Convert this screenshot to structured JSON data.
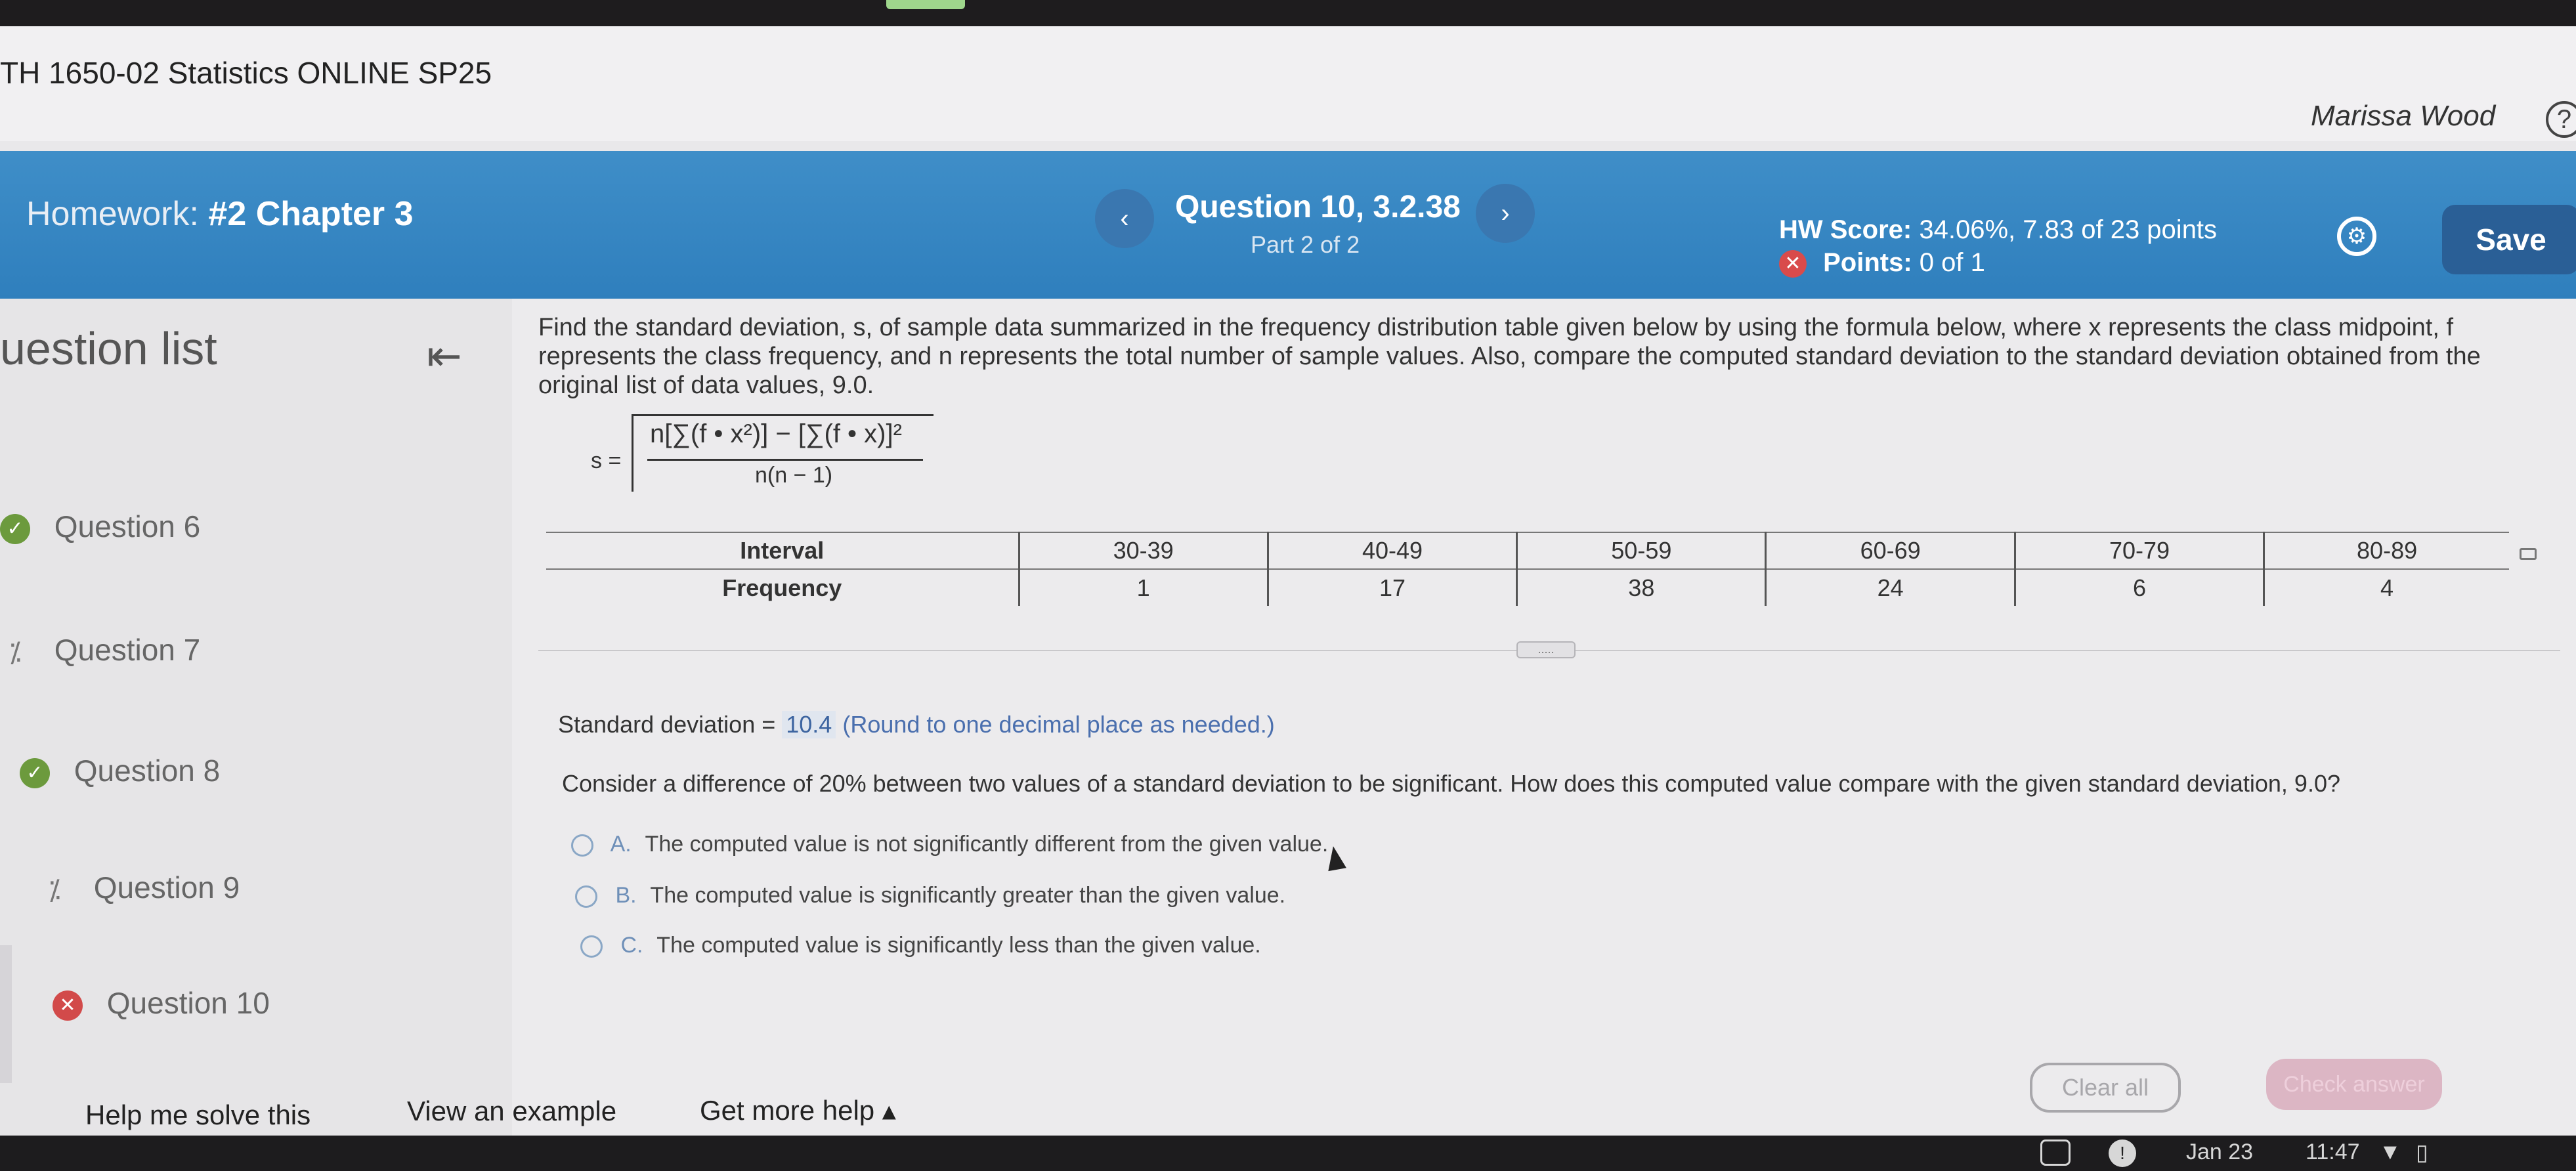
{
  "course": {
    "title": "TH 1650-02 Statistics ONLINE SP25",
    "user": "Marissa Wood"
  },
  "header": {
    "homework_prefix": "Homework:",
    "homework_name": "#2 Chapter 3",
    "question_title": "Question 10, 3.2.38",
    "question_part": "Part 2 of 2",
    "score_label": "HW Score:",
    "score_value": "34.06%, 7.83 of 23 points",
    "points_label": "Points:",
    "points_value": "0 of 1",
    "save_label": "Save",
    "prev_icon": "chevron-left-icon",
    "next_icon": "chevron-right-icon"
  },
  "sidebar": {
    "title": "uestion list",
    "items": [
      {
        "label": "Question 6",
        "status": "correct"
      },
      {
        "label": "Question 7",
        "status": "partial"
      },
      {
        "label": "Question 8",
        "status": "correct"
      },
      {
        "label": "Question 9",
        "status": "partial"
      },
      {
        "label": "Question 10",
        "status": "incorrect"
      }
    ]
  },
  "problem": {
    "prompt": "Find the standard deviation, s, of sample data summarized in the frequency distribution table given below by using the formula below, where x represents the class midpoint, f represents the class frequency, and n represents the total number of sample values. Also, compare the computed standard deviation to the standard deviation obtained from the original list of data values, 9.0.",
    "formula_lhs": "s =",
    "formula_numerator": "n[∑(f • x²)] − [∑(f • x)]²",
    "formula_denominator": "n(n − 1)",
    "table": {
      "row_labels": [
        "Interval",
        "Frequency"
      ],
      "intervals": [
        "30-39",
        "40-49",
        "50-59",
        "60-69",
        "70-79",
        "80-89"
      ],
      "frequencies": [
        "1",
        "17",
        "38",
        "24",
        "6",
        "4"
      ]
    },
    "more_label": "....."
  },
  "answer": {
    "prefix": "Standard deviation =",
    "value": "10.4",
    "note": "(Round to one decimal place as needed.)"
  },
  "part2": {
    "question": "Consider a difference of 20% between two values of a standard deviation to be significant. How does this computed value compare with the given standard deviation, 9.0?",
    "options": [
      {
        "letter": "A.",
        "text": "The computed value is not significantly different from the given value."
      },
      {
        "letter": "B.",
        "text": "The computed value is significantly greater than the given value."
      },
      {
        "letter": "C.",
        "text": "The computed value is significantly less than the given value."
      }
    ]
  },
  "footer": {
    "help_solve": "Help me solve this",
    "view_example": "View an example",
    "get_help": "Get more help ▴",
    "clear_all": "Clear all",
    "check_answer": "Check answer"
  },
  "taskbar": {
    "date": "Jan 23",
    "time": "11:47"
  }
}
